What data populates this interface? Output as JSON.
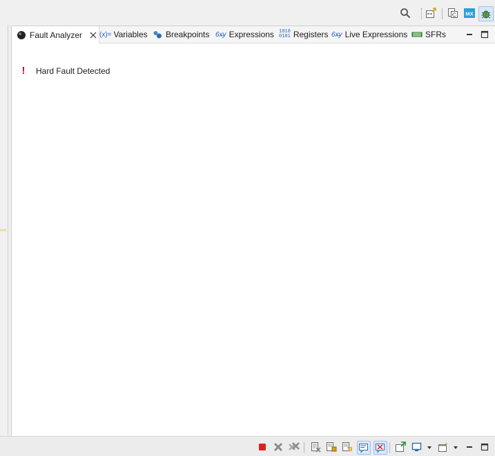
{
  "tabs": [
    {
      "label": "Fault Analyzer",
      "icon": "fault-analyzer-icon",
      "active": true
    },
    {
      "label": "Variables",
      "icon": "variables-icon",
      "icon_text": "(x)="
    },
    {
      "label": "Breakpoints",
      "icon": "breakpoints-icon"
    },
    {
      "label": "Expressions",
      "icon": "expressions-icon",
      "icon_text": "6x̶y"
    },
    {
      "label": "Registers",
      "icon": "registers-icon",
      "icon_text_top": "1010",
      "icon_text_bottom": "0101"
    },
    {
      "label": "Live Expressions",
      "icon": "live-expressions-icon",
      "icon_text": "6x̶y"
    },
    {
      "label": "SFRs",
      "icon": "sfrs-icon"
    }
  ],
  "toolbar": {
    "mx_badge": "MX"
  },
  "content": {
    "message": "Hard Fault Detected",
    "message_icon": "error-exclamation-icon",
    "exclamation": "!"
  },
  "colors": {
    "error": "#c8102e",
    "accent": "#2b8fd6",
    "stop": "#e02020"
  }
}
